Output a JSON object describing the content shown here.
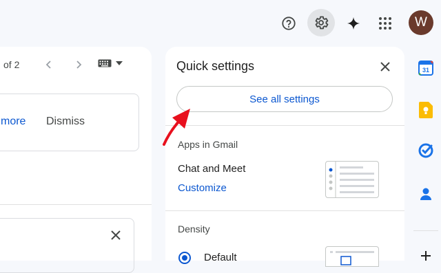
{
  "header": {
    "help_icon": "help-circle-icon",
    "settings_icon": "gear-icon",
    "gemini_icon": "sparkle-icon",
    "apps_icon": "apps-grid-icon",
    "avatar_letter": "W",
    "avatar_color": "#6a3a2c"
  },
  "mail": {
    "pager_text": "of 2",
    "notice": {
      "more_label": "more",
      "dismiss_label": "Dismiss"
    }
  },
  "quick_settings": {
    "title": "Quick settings",
    "see_all_label": "See all settings",
    "apps_section_label": "Apps in Gmail",
    "chat_meet_label": "Chat and Meet",
    "customize_label": "Customize",
    "density_label": "Density",
    "density_default_label": "Default"
  },
  "side_apps": [
    "calendar-icon",
    "keep-icon",
    "tasks-icon",
    "contacts-icon",
    "add-icon"
  ],
  "colors": {
    "accent": "#0b57d0",
    "arrow": "#e8101e",
    "background": "#f6f8fc"
  }
}
